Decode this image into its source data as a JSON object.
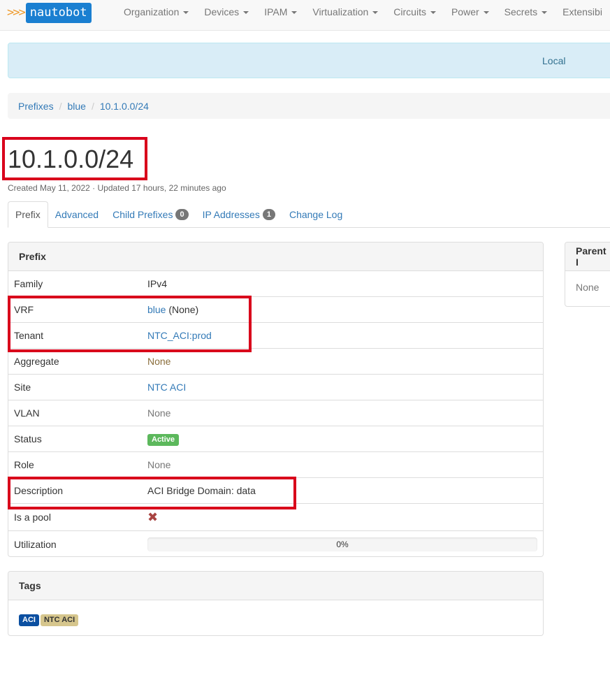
{
  "navbar": {
    "brand_chevrons": ">>>",
    "brand_name": "nautobot",
    "items": [
      "Organization",
      "Devices",
      "IPAM",
      "Virtualization",
      "Circuits",
      "Power",
      "Secrets",
      "Extensibi"
    ]
  },
  "banner": {
    "text": "Local"
  },
  "breadcrumb": [
    "Prefixes",
    "blue",
    "10.1.0.0/24"
  ],
  "page": {
    "title": "10.1.0.0/24",
    "meta": "Created May 11, 2022 · Updated 17 hours, 22 minutes ago"
  },
  "tabs": [
    {
      "label": "Prefix"
    },
    {
      "label": "Advanced"
    },
    {
      "label": "Child Prefixes",
      "badge": "0"
    },
    {
      "label": "IP Addresses",
      "badge": "1"
    },
    {
      "label": "Change Log"
    }
  ],
  "prefix_panel": {
    "heading": "Prefix",
    "rows": {
      "family": {
        "label": "Family",
        "value": "IPv4"
      },
      "vrf": {
        "label": "VRF",
        "link": "blue",
        "suffix": " (None)"
      },
      "tenant": {
        "label": "Tenant",
        "link": "NTC_ACI:prod"
      },
      "aggregate": {
        "label": "Aggregate",
        "value": "None"
      },
      "site": {
        "label": "Site",
        "link": "NTC ACI"
      },
      "vlan": {
        "label": "VLAN",
        "value": "None"
      },
      "status": {
        "label": "Status",
        "value": "Active"
      },
      "role": {
        "label": "Role",
        "value": "None"
      },
      "description": {
        "label": "Description",
        "value": "ACI Bridge Domain: data"
      },
      "pool": {
        "label": "Is a pool",
        "icon": "x-icon",
        "value": false
      },
      "utilization": {
        "label": "Utilization",
        "value": "0%",
        "fraction": 0
      }
    }
  },
  "parent_panel": {
    "heading": "Parent I",
    "value": "None"
  },
  "tags_panel": {
    "heading": "Tags",
    "tags": [
      {
        "label": "ACI",
        "bg": "#0b4fa1",
        "fg": "#ffffff"
      },
      {
        "label": "NTC ACI",
        "bg": "#d6c68d",
        "fg": "#333333"
      }
    ]
  },
  "colors": {
    "highlight": "#d9001b",
    "link": "#337ab7",
    "active": "#5cb85c",
    "brand": "#1a7fd1"
  }
}
